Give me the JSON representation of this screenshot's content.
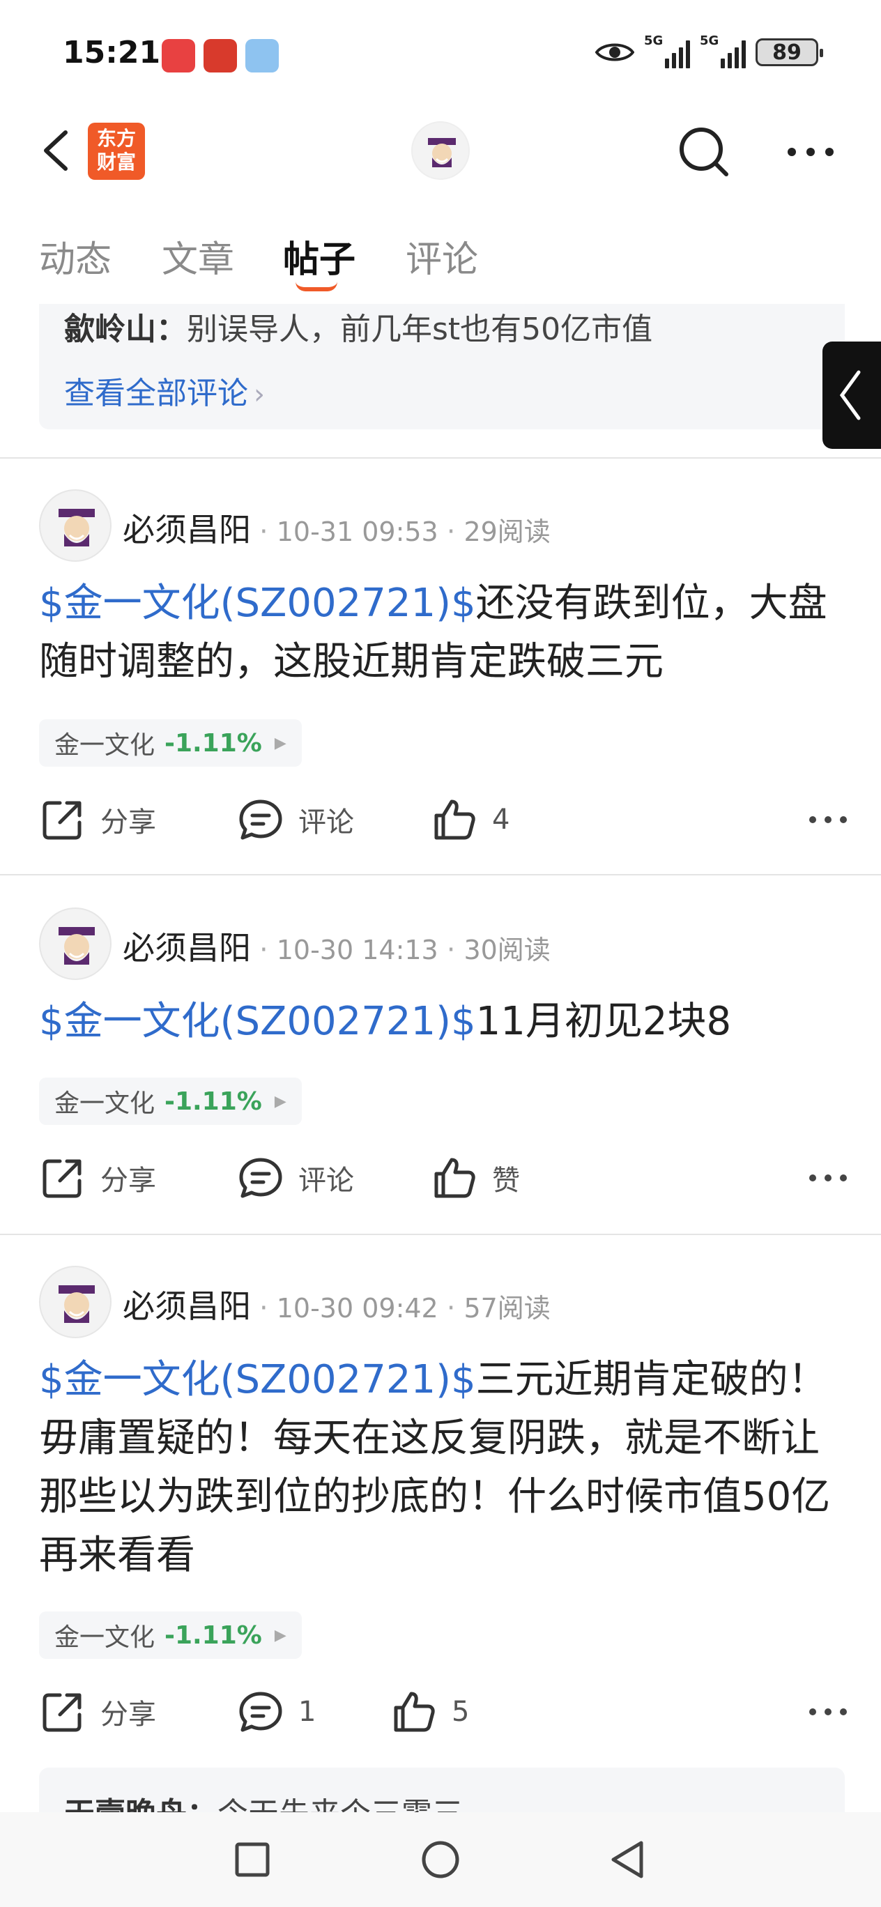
{
  "status_bar": {
    "time": "15:21",
    "network_1": "5G",
    "network_2": "5G",
    "battery": "89"
  },
  "nav": {
    "logo_line1": "东方",
    "logo_line2": "财富"
  },
  "tabs": [
    {
      "label": "动态"
    },
    {
      "label": "文章"
    },
    {
      "label": "帖子"
    },
    {
      "label": "评论"
    }
  ],
  "comment_preview": {
    "author": "歙岭山：",
    "text": "别误导人，前几年st也有50亿市值",
    "view_all": "查看全部评论"
  },
  "posts": [
    {
      "author": "必须昌阳",
      "time": "10-31 09:53",
      "reads": "29阅读",
      "stock_tag": "$金一文化(SZ002721)$",
      "text": "还没有跌到位，大盘随时调整的，这股近期肯定跌破三元",
      "chip_name": "金一文化",
      "chip_pct": "-1.11%",
      "share": "分享",
      "comment": "评论",
      "like": "4"
    },
    {
      "author": "必须昌阳",
      "time": "10-30 14:13",
      "reads": "30阅读",
      "stock_tag": "$金一文化(SZ002721)$",
      "text": "11月初见2块8",
      "chip_name": "金一文化",
      "chip_pct": "-1.11%",
      "share": "分享",
      "comment": "评论",
      "like": "赞"
    },
    {
      "author": "必须昌阳",
      "time": "10-30 09:42",
      "reads": "57阅读",
      "stock_tag": "$金一文化(SZ002721)$",
      "text": "三元近期肯定破的！毋庸置疑的！每天在这反复阴跌，就是不断让那些以为跌到位的抄底的！什么时候市值50亿再来看看",
      "chip_name": "金一文化",
      "chip_pct": "-1.11%",
      "share": "分享",
      "comment": "1",
      "like": "5"
    }
  ],
  "bottom_preview": {
    "author": "天壹晚舟：",
    "text": "今天先来个三零三"
  },
  "colors": {
    "accent": "#f05a28",
    "link": "#2f6bcb",
    "down": "#3aa35a"
  }
}
